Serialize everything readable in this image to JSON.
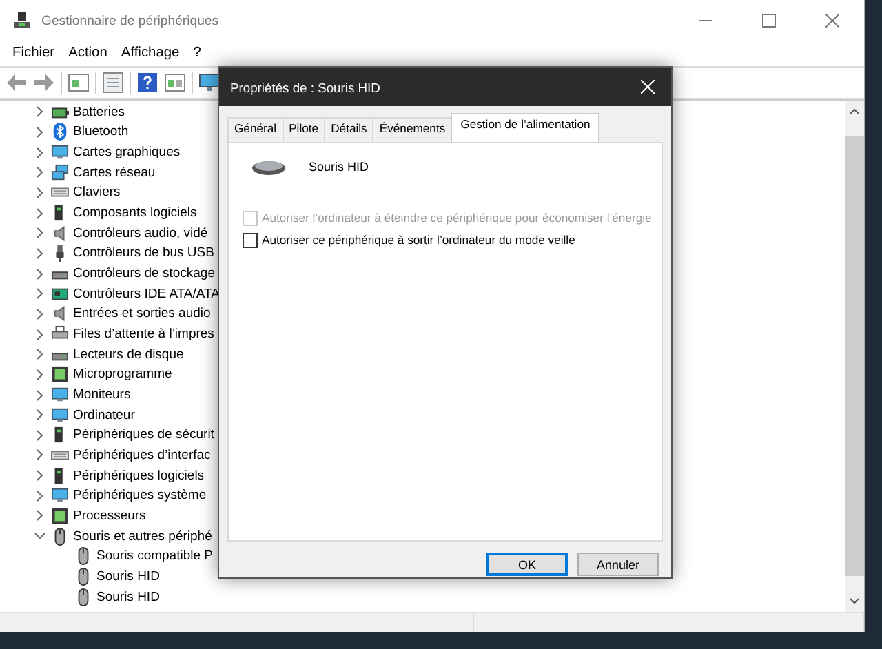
{
  "window": {
    "title": "Gestionnaire de périphériques"
  },
  "menu": [
    "Fichier",
    "Action",
    "Affichage",
    "?"
  ],
  "tree": [
    {
      "label": "Batteries",
      "expanded": false
    },
    {
      "label": "Bluetooth",
      "expanded": false
    },
    {
      "label": "Cartes graphiques",
      "expanded": false
    },
    {
      "label": "Cartes réseau",
      "expanded": false
    },
    {
      "label": "Claviers",
      "expanded": false
    },
    {
      "label": "Composants logiciels",
      "expanded": false
    },
    {
      "label": "Contrôleurs audio, vidé",
      "expanded": false
    },
    {
      "label": "Contrôleurs de bus USB",
      "expanded": false
    },
    {
      "label": "Contrôleurs de stockage",
      "expanded": false
    },
    {
      "label": "Contrôleurs IDE ATA/ATA",
      "expanded": false
    },
    {
      "label": "Entrées et sorties audio",
      "expanded": false
    },
    {
      "label": "Files d’attente à l’impres",
      "expanded": false
    },
    {
      "label": "Lecteurs de disque",
      "expanded": false
    },
    {
      "label": "Microprogramme",
      "expanded": false
    },
    {
      "label": "Moniteurs",
      "expanded": false
    },
    {
      "label": "Ordinateur",
      "expanded": false
    },
    {
      "label": "Périphériques de sécurit",
      "expanded": false
    },
    {
      "label": "Périphériques d’interfac",
      "expanded": false
    },
    {
      "label": "Périphériques logiciels",
      "expanded": false
    },
    {
      "label": "Périphériques système",
      "expanded": false
    },
    {
      "label": "Processeurs",
      "expanded": false
    },
    {
      "label": "Souris et autres périphé",
      "expanded": true,
      "children": [
        {
          "label": "Souris compatible P"
        },
        {
          "label": "Souris HID"
        },
        {
          "label": "Souris HID"
        }
      ]
    }
  ],
  "dialog": {
    "title": "Propriétés de : Souris HID",
    "tabs": [
      {
        "label": "Général",
        "selected": false
      },
      {
        "label": "Pilote",
        "selected": false
      },
      {
        "label": "Détails",
        "selected": false
      },
      {
        "label": "Événements",
        "selected": false
      },
      {
        "label": "Gestion de l’alimentation",
        "selected": true
      }
    ],
    "device": "Souris HID",
    "options": [
      {
        "label": "Autoriser l’ordinateur à éteindre ce périphérique pour économiser l’énergie",
        "checked": false,
        "disabled": true
      },
      {
        "label": "Autoriser ce périphérique à sortir l’ordinateur du mode veille",
        "checked": false,
        "disabled": false
      }
    ],
    "buttons": [
      {
        "label": "OK",
        "default": true
      },
      {
        "label": "Annuler",
        "default": false
      }
    ]
  }
}
